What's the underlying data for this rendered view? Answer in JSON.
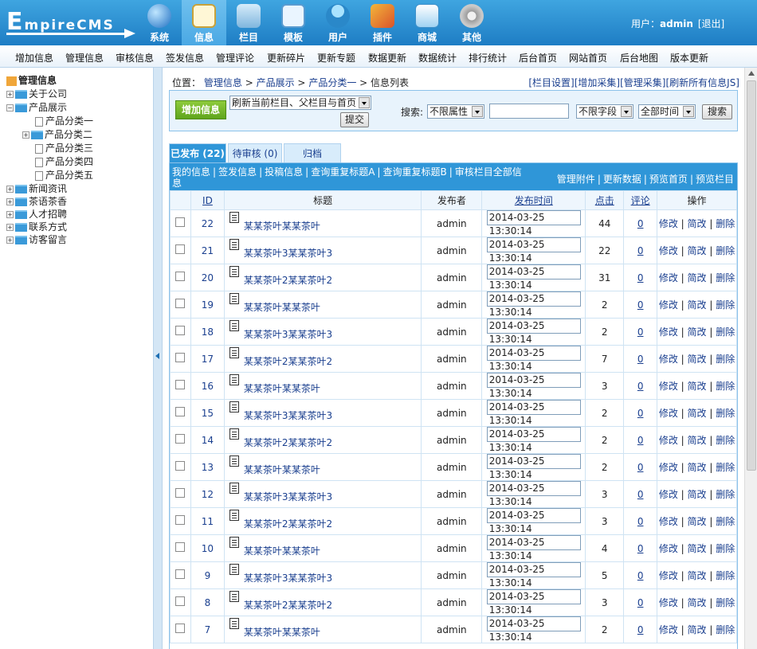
{
  "header": {
    "logo_text": "EmpireCMS",
    "logo_first": "E",
    "logo_rest": "mpireCMS",
    "nav": [
      {
        "label": "系统",
        "icon": "globe-icon"
      },
      {
        "label": "信息",
        "icon": "notepad-icon"
      },
      {
        "label": "栏目",
        "icon": "folder-icon"
      },
      {
        "label": "模板",
        "icon": "window-icon"
      },
      {
        "label": "用户",
        "icon": "user-icon"
      },
      {
        "label": "插件",
        "icon": "tools-icon"
      },
      {
        "label": "商城",
        "icon": "card-icon"
      },
      {
        "label": "其他",
        "icon": "gear-icon"
      }
    ],
    "user_label": "用户：",
    "username": "admin",
    "logout": "[退出]"
  },
  "menubar": [
    "增加信息",
    "管理信息",
    "审核信息",
    "签发信息",
    "管理评论",
    "更新碎片",
    "更新专题",
    "数据更新",
    "数据统计",
    "排行统计",
    "后台首页",
    "网站首页",
    "后台地图",
    "版本更新"
  ],
  "sidebar": {
    "root": "管理信息",
    "items": [
      {
        "label": "关于公司",
        "pm": "+"
      },
      {
        "label": "产品展示",
        "pm": "−"
      },
      {
        "label": "产品分类一"
      },
      {
        "label": "产品分类二",
        "pm": "+"
      },
      {
        "label": "产品分类三"
      },
      {
        "label": "产品分类四"
      },
      {
        "label": "产品分类五"
      },
      {
        "label": "新闻资讯",
        "pm": "+"
      },
      {
        "label": "茶语茶香",
        "pm": "+"
      },
      {
        "label": "人才招聘",
        "pm": "+"
      },
      {
        "label": "联系方式",
        "pm": "+"
      },
      {
        "label": "访客留言",
        "pm": "+"
      }
    ]
  },
  "breadcrumb": {
    "prefix": "位置：",
    "links": [
      "管理信息",
      "产品展示",
      "产品分类一"
    ],
    "sep": ">",
    "current": "信息列表"
  },
  "toplinks": [
    "[栏目设置]",
    "[增加采集]",
    "[管理采集]",
    "[刷新所有信息JS]"
  ],
  "filter": {
    "add_button": "增加信息",
    "refresh_select": "刷新当前栏目、父栏目与首页",
    "submit": "提交",
    "search_label": "搜索:",
    "attr_select": "不限属性",
    "search_value": "",
    "field_select": "不限字段",
    "time_select": "全部时间",
    "search_button": "搜索"
  },
  "tabs": [
    "已发布 (22)",
    "待审核 (0)",
    "归档"
  ],
  "toolbar": {
    "left": [
      "我的信息",
      "签发信息",
      "投稿信息",
      "查询重复标题A",
      "查询重复标题B",
      "审核栏目全部信息"
    ],
    "right": [
      "管理附件",
      "更新数据",
      "预览首页",
      "预览栏目"
    ],
    "sep": "|"
  },
  "table": {
    "headers": [
      "ID",
      "标题",
      "发布者",
      "发布时间",
      "点击",
      "评论",
      "操作"
    ],
    "ops": {
      "edit": "修改",
      "simple_edit": "简改",
      "delete": "删除",
      "sep": "|"
    },
    "rows": [
      {
        "id": "22",
        "title": "某某茶叶某某茶叶",
        "author": "admin",
        "time": "2014-03-25 13:30:14",
        "clicks": "44",
        "comments": "0"
      },
      {
        "id": "21",
        "title": "某某茶叶3某某茶叶3",
        "author": "admin",
        "time": "2014-03-25 13:30:14",
        "clicks": "22",
        "comments": "0"
      },
      {
        "id": "20",
        "title": "某某茶叶2某某茶叶2",
        "author": "admin",
        "time": "2014-03-25 13:30:14",
        "clicks": "31",
        "comments": "0"
      },
      {
        "id": "19",
        "title": "某某茶叶某某茶叶",
        "author": "admin",
        "time": "2014-03-25 13:30:14",
        "clicks": "2",
        "comments": "0"
      },
      {
        "id": "18",
        "title": "某某茶叶3某某茶叶3",
        "author": "admin",
        "time": "2014-03-25 13:30:14",
        "clicks": "2",
        "comments": "0"
      },
      {
        "id": "17",
        "title": "某某茶叶2某某茶叶2",
        "author": "admin",
        "time": "2014-03-25 13:30:14",
        "clicks": "7",
        "comments": "0"
      },
      {
        "id": "16",
        "title": "某某茶叶某某茶叶",
        "author": "admin",
        "time": "2014-03-25 13:30:14",
        "clicks": "3",
        "comments": "0"
      },
      {
        "id": "15",
        "title": "某某茶叶3某某茶叶3",
        "author": "admin",
        "time": "2014-03-25 13:30:14",
        "clicks": "2",
        "comments": "0"
      },
      {
        "id": "14",
        "title": "某某茶叶2某某茶叶2",
        "author": "admin",
        "time": "2014-03-25 13:30:14",
        "clicks": "2",
        "comments": "0"
      },
      {
        "id": "13",
        "title": "某某茶叶某某茶叶",
        "author": "admin",
        "time": "2014-03-25 13:30:14",
        "clicks": "2",
        "comments": "0"
      },
      {
        "id": "12",
        "title": "某某茶叶3某某茶叶3",
        "author": "admin",
        "time": "2014-03-25 13:30:14",
        "clicks": "3",
        "comments": "0"
      },
      {
        "id": "11",
        "title": "某某茶叶2某某茶叶2",
        "author": "admin",
        "time": "2014-03-25 13:30:14",
        "clicks": "3",
        "comments": "0"
      },
      {
        "id": "10",
        "title": "某某茶叶某某茶叶",
        "author": "admin",
        "time": "2014-03-25 13:30:14",
        "clicks": "4",
        "comments": "0"
      },
      {
        "id": "9",
        "title": "某某茶叶3某某茶叶3",
        "author": "admin",
        "time": "2014-03-25 13:30:14",
        "clicks": "5",
        "comments": "0"
      },
      {
        "id": "8",
        "title": "某某茶叶2某某茶叶2",
        "author": "admin",
        "time": "2014-03-25 13:30:14",
        "clicks": "3",
        "comments": "0"
      },
      {
        "id": "7",
        "title": "某某茶叶某某茶叶",
        "author": "admin",
        "time": "2014-03-25 13:30:14",
        "clicks": "2",
        "comments": "0"
      }
    ]
  },
  "colors": {
    "header_blue": "#1e7dc4",
    "tab_active": "#2f96d8",
    "add_green": "#6fb82a",
    "link": "#1a3f8f"
  }
}
